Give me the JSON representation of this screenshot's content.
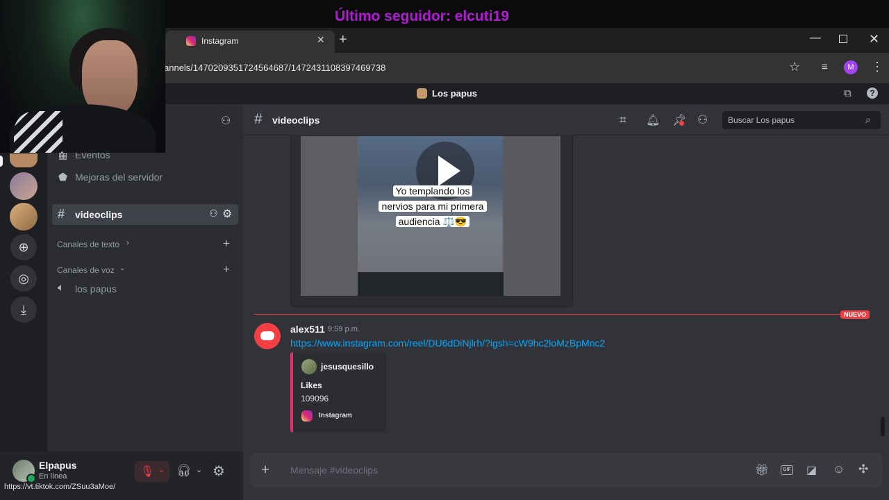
{
  "overlay": {
    "follower_text": "Último seguidor: elcuti19"
  },
  "browser": {
    "tab_title": "Instagram",
    "url": "annels/1470209351724564687/1472431108397469738",
    "profile_initial": "M",
    "colors": {
      "profile": "#a142f4"
    }
  },
  "discord": {
    "server_name": "Los papus",
    "sidebar": {
      "events_label": "Eventos",
      "boost_label": "Mejoras del servidor",
      "active_channel": "videoclips",
      "text_category": "Canales de texto",
      "voice_category": "Canales de voz",
      "voice_channel": "los papus"
    },
    "header": {
      "channel": "videoclips",
      "search_placeholder": "Buscar Los papus"
    },
    "video": {
      "caption_line1": "Yo templando los",
      "caption_line2": "nervios para mi primera",
      "caption_line3": "audiencia ⚖️😎"
    },
    "new_divider": "NUEVO",
    "message": {
      "author": "alex511",
      "time": "9:59 p.m.",
      "link": "https://www.instagram.com/reel/DU6dDiNjlrh/?igsh=cW9hc2loMzBpMnc2",
      "embed": {
        "author": "jesusquesillo",
        "likes_label": "Likes",
        "likes_value": "109096",
        "footer": "Instagram"
      }
    },
    "composer": {
      "placeholder": "Mensaje #videoclips"
    },
    "user": {
      "name": "Elpapus",
      "status": "En línea"
    },
    "colors": {
      "blurple": "#5865f2",
      "new_red": "#f23f43",
      "link": "#00a8fc",
      "embed_bar": "#e1306c",
      "online": "#23a55a"
    }
  },
  "status_bar": {
    "url": "https://vt.tiktok.com/ZSuu3aMoe/"
  }
}
